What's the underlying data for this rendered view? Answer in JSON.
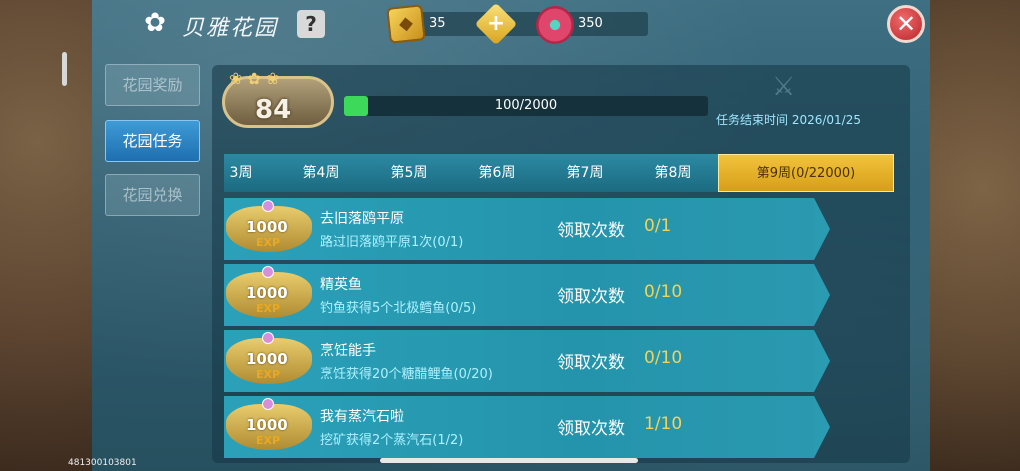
{
  "header": {
    "title": "贝雅花园",
    "help_label": "?",
    "gem_value": "35",
    "plus_label": "+",
    "flower_value": "350",
    "close_label": "✕"
  },
  "nav": [
    {
      "label": "花园奖励",
      "active": false
    },
    {
      "label": "花园任务",
      "active": true
    },
    {
      "label": "花园兑换",
      "active": false
    }
  ],
  "level": {
    "value": "84",
    "progress_text": "100/2000",
    "progress_fraction": 0.05
  },
  "end_time": "任务结束时间 2026/01/25",
  "tabs": [
    {
      "label": "3周",
      "active": false
    },
    {
      "label": "第4周",
      "active": false
    },
    {
      "label": "第5周",
      "active": false
    },
    {
      "label": "第6周",
      "active": false
    },
    {
      "label": "第7周",
      "active": false
    },
    {
      "label": "第8周",
      "active": false
    },
    {
      "label": "第9周(0/22000)",
      "active": true
    }
  ],
  "tasks": [
    {
      "reward": "1000",
      "exp": "EXP",
      "name": "去旧落鸥平原",
      "desc": "路过旧落鸥平原1次(0/1)",
      "claim_label": "领取次数",
      "claim_count": "0/1"
    },
    {
      "reward": "1000",
      "exp": "EXP",
      "name": "精英鱼",
      "desc": "钓鱼获得5个北极鳕鱼(0/5)",
      "claim_label": "领取次数",
      "claim_count": "0/10"
    },
    {
      "reward": "1000",
      "exp": "EXP",
      "name": "烹饪能手",
      "desc": "烹饪获得20个糖醋鲤鱼(0/20)",
      "claim_label": "领取次数",
      "claim_count": "0/10"
    },
    {
      "reward": "1000",
      "exp": "EXP",
      "name": "我有蒸汽石啦",
      "desc": "挖矿获得2个蒸汽石(1/2)",
      "claim_label": "领取次数",
      "claim_count": "1/10"
    }
  ],
  "footer": {
    "uid": "481300103801"
  },
  "colors": {
    "accent_gold": "#f2d35a",
    "nav_active": "#2a86c8",
    "progress": "#3cd95a"
  }
}
